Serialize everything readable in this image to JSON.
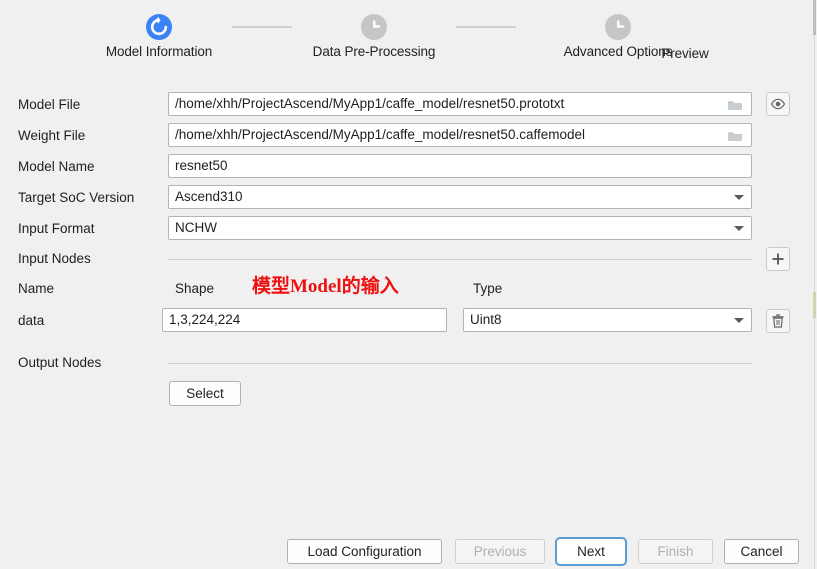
{
  "window": {
    "background": "#f0f0f0",
    "accent": "#3b82f6"
  },
  "stepper": {
    "steps": [
      {
        "label": "Model Information",
        "state": "current",
        "icon": "refresh-icon"
      },
      {
        "label": "Data Pre-Processing",
        "state": "pending",
        "icon": "clock-icon"
      },
      {
        "label": "Advanced Options",
        "state": "pending",
        "icon": "clock-icon"
      },
      {
        "label": "Preview",
        "state": "pending",
        "icon": "clock-icon"
      }
    ]
  },
  "form": {
    "model_file": {
      "label": "Model File",
      "value": "/home/xhh/ProjectAscend/MyApp1/caffe_model/resnet50.prototxt",
      "browse_icon": "folder-icon"
    },
    "weight_file": {
      "label": "Weight File",
      "value": "/home/xhh/ProjectAscend/MyApp1/caffe_model/resnet50.caffemodel",
      "browse_icon": "folder-icon"
    },
    "model_name": {
      "label": "Model Name",
      "value": "resnet50"
    },
    "target_soc_version": {
      "label": "Target SoC Version",
      "value": "Ascend310",
      "options": [
        "Ascend310"
      ]
    },
    "input_format": {
      "label": "Input Format",
      "value": "NCHW",
      "options": [
        "NCHW"
      ]
    },
    "preview_button": {
      "icon": "eye-icon",
      "title": ""
    },
    "add_button": {
      "icon": "plus-icon",
      "label": "+"
    },
    "delete_button": {
      "icon": "trash-icon"
    }
  },
  "input_nodes": {
    "section_label": "Input Nodes",
    "columns": {
      "name": "Name",
      "shape": "Shape",
      "type": "Type"
    },
    "annotation": "模型Model的输入",
    "rows": [
      {
        "name": "data",
        "shape": "1,3,224,224",
        "type": "Uint8",
        "type_options": [
          "Uint8"
        ]
      }
    ]
  },
  "output_nodes": {
    "section_label": "Output Nodes",
    "select_button": "Select"
  },
  "footer": {
    "load_configuration": "Load Configuration",
    "previous": "Previous",
    "next": "Next",
    "finish": "Finish",
    "cancel": "Cancel"
  }
}
